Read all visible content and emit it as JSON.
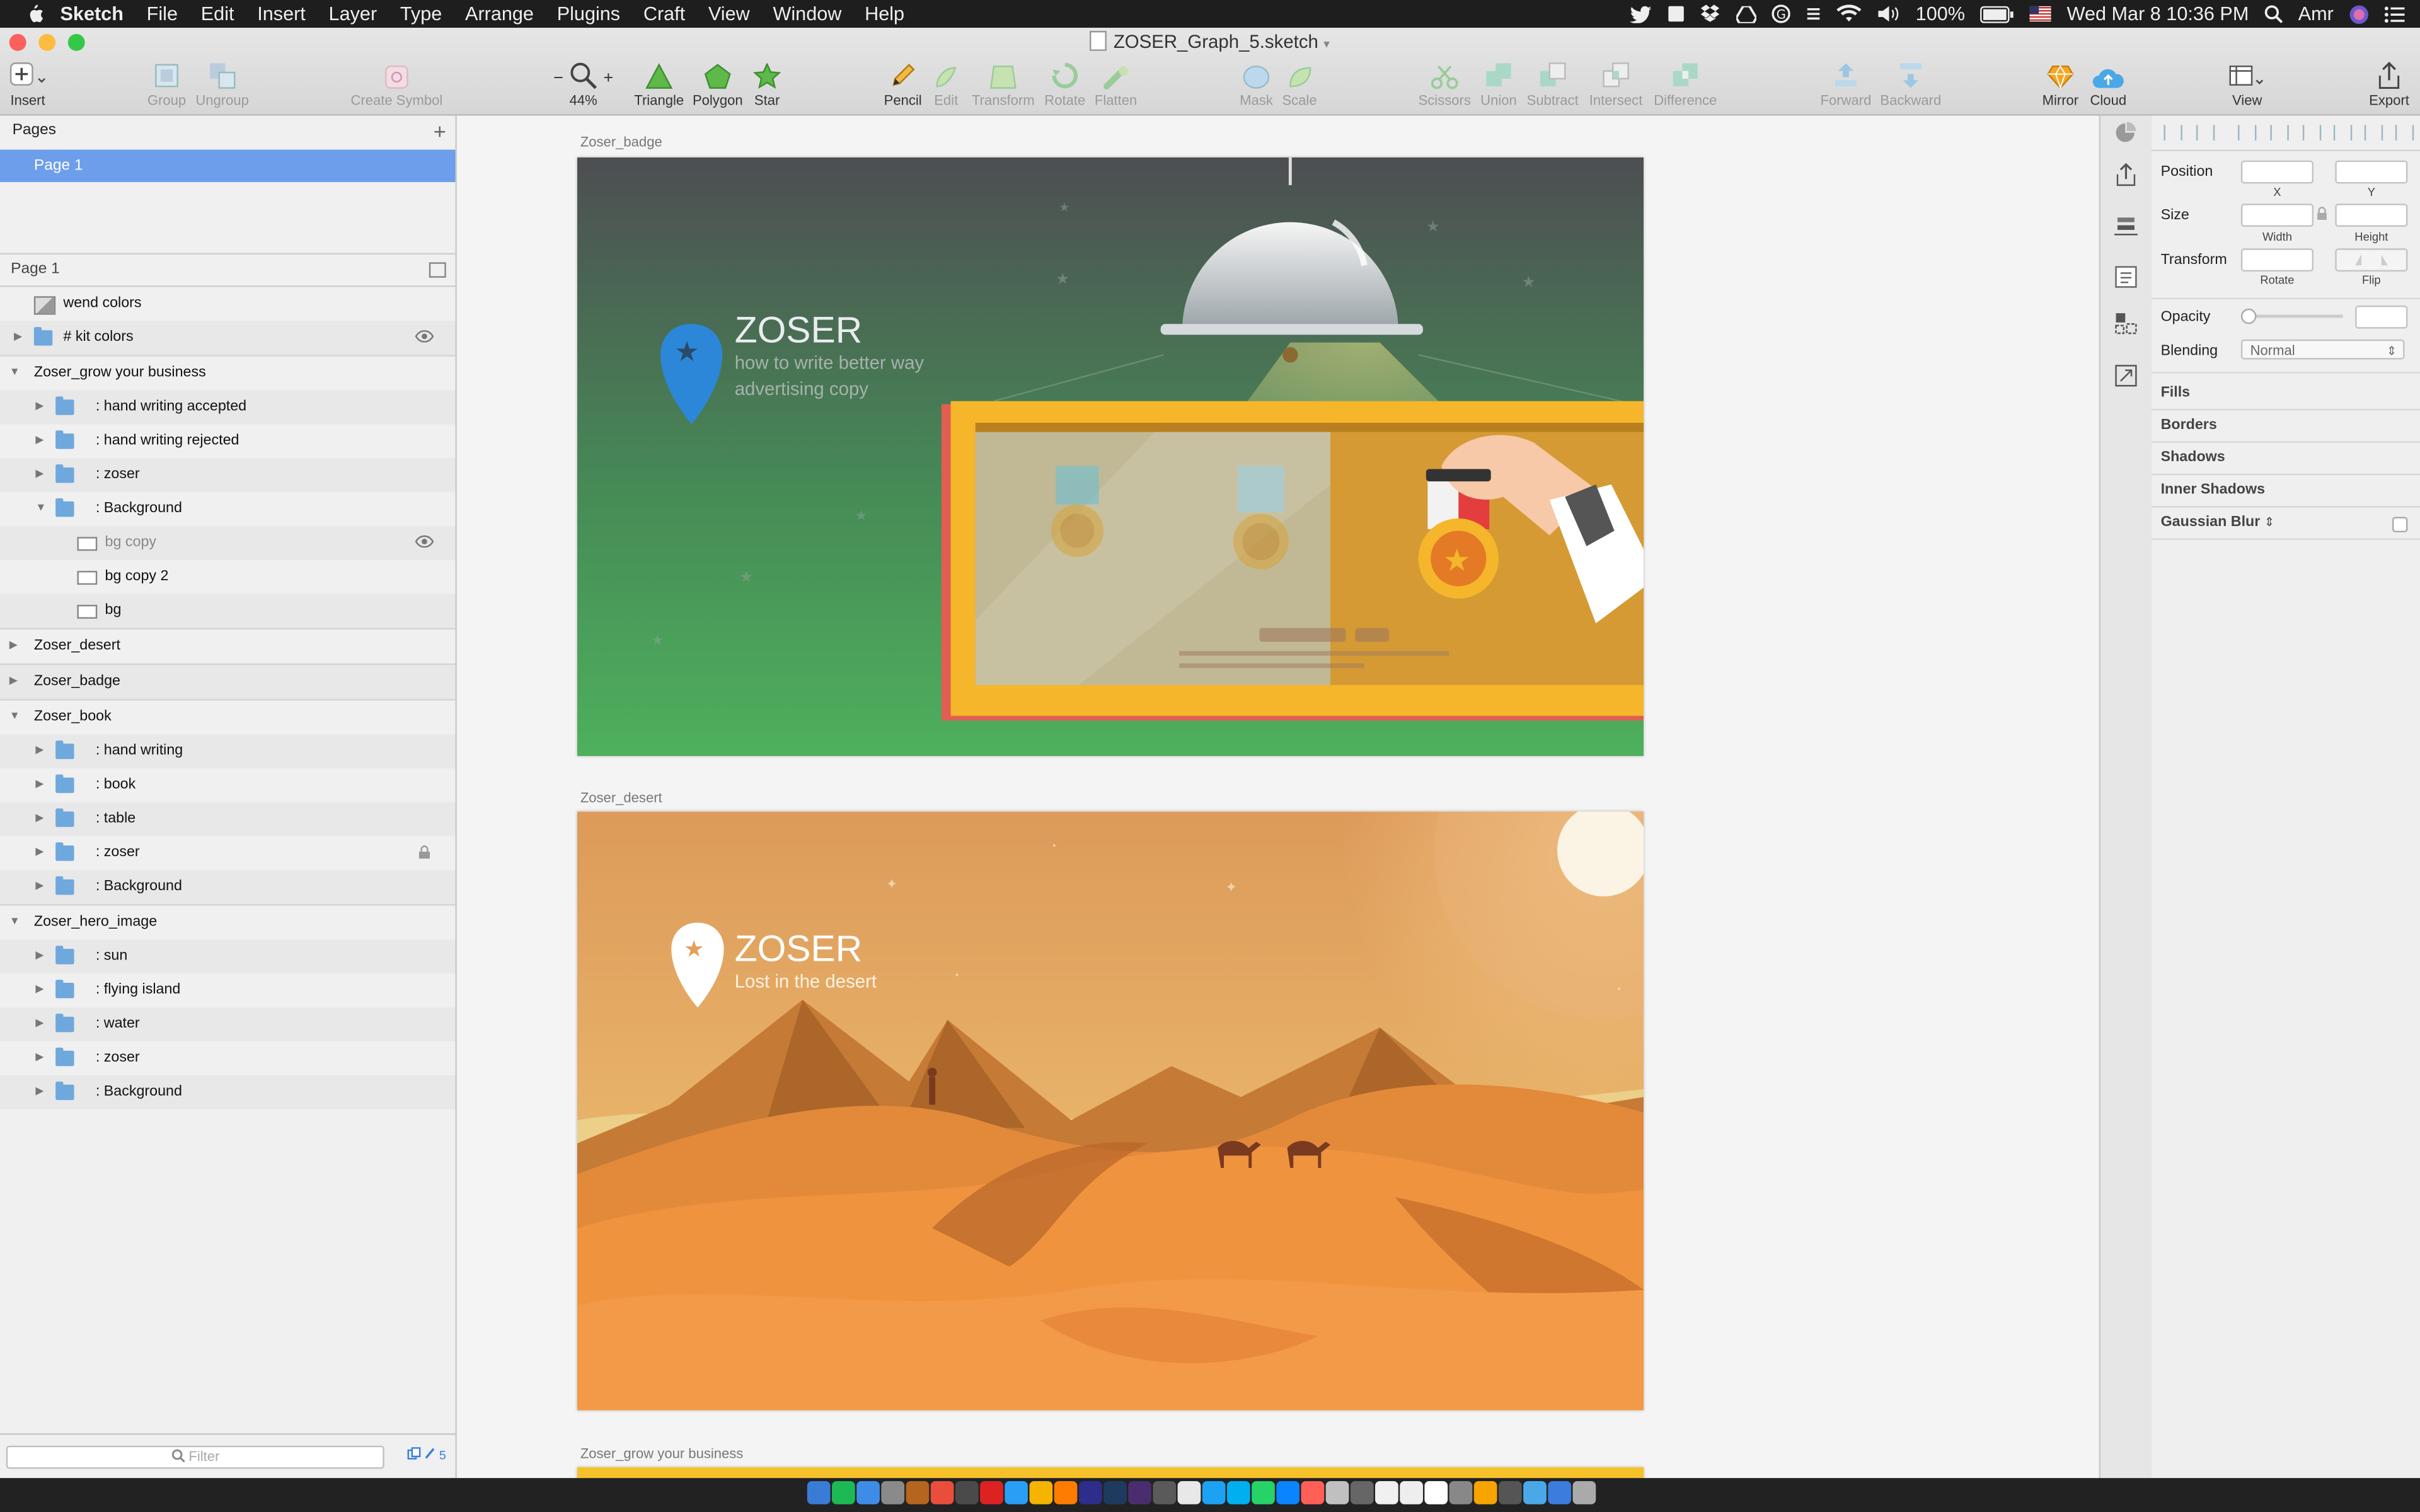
{
  "menubar": {
    "app_name": "Sketch",
    "menus": [
      "File",
      "Edit",
      "Insert",
      "Layer",
      "Type",
      "Arrange",
      "Plugins",
      "Craft",
      "View",
      "Window",
      "Help"
    ],
    "battery": "100%",
    "datetime": "Wed Mar 8  10:36 PM",
    "user": "Amr"
  },
  "window": {
    "title": "ZOSER_Graph_5.sketch"
  },
  "toolbar": {
    "insert": "Insert",
    "group": "Group",
    "ungroup": "Ungroup",
    "create_symbol": "Create Symbol",
    "zoom_minus": "−",
    "zoom_plus": "+",
    "zoom": "44%",
    "triangle": "Triangle",
    "polygon": "Polygon",
    "star": "Star",
    "pencil": "Pencil",
    "edit": "Edit",
    "transform": "Transform",
    "rotate": "Rotate",
    "flatten": "Flatten",
    "mask": "Mask",
    "scale": "Scale",
    "scissors": "Scissors",
    "union": "Union",
    "subtract": "Subtract",
    "intersect": "Intersect",
    "difference": "Difference",
    "forward": "Forward",
    "backward": "Backward",
    "mirror": "Mirror",
    "cloud": "Cloud",
    "view": "View",
    "export": "Export"
  },
  "sidebar": {
    "pages_title": "Pages",
    "add_page": "+",
    "pages": [
      "Page 1"
    ],
    "layers_title": "Page 1",
    "layers": [
      {
        "label": "wend colors",
        "kind": "image",
        "indent": 0,
        "arrow": "",
        "grey": false,
        "eye": false,
        "lock": false
      },
      {
        "label": "#  kit colors",
        "kind": "folder",
        "indent": 0,
        "arrow": "▶",
        "grey": false,
        "eye": true,
        "lock": false
      },
      {
        "label": "Zoser_grow your business",
        "kind": "artboard",
        "indent": 0,
        "arrow": "▼",
        "grey": false,
        "eye": false,
        "lock": false
      },
      {
        "label": ":  hand writing accepted",
        "kind": "folder",
        "indent": 1,
        "arrow": "▶",
        "grey": false,
        "eye": false,
        "lock": false
      },
      {
        "label": ":  hand writing  rejected",
        "kind": "folder",
        "indent": 1,
        "arrow": "▶",
        "grey": false,
        "eye": false,
        "lock": false
      },
      {
        "label": ":  zoser",
        "kind": "folder",
        "indent": 1,
        "arrow": "▶",
        "grey": false,
        "eye": false,
        "lock": false
      },
      {
        "label": ":  Background",
        "kind": "folder",
        "indent": 1,
        "arrow": "▼",
        "grey": false,
        "eye": false,
        "lock": false
      },
      {
        "label": "bg copy",
        "kind": "rect",
        "indent": 2,
        "arrow": "",
        "grey": true,
        "eye": true,
        "lock": false
      },
      {
        "label": "bg copy 2",
        "kind": "rect",
        "indent": 2,
        "arrow": "",
        "grey": false,
        "eye": false,
        "lock": false
      },
      {
        "label": "bg",
        "kind": "rect",
        "indent": 2,
        "arrow": "",
        "grey": false,
        "eye": false,
        "lock": false
      },
      {
        "label": "Zoser_desert",
        "kind": "artboard",
        "indent": 0,
        "arrow": "▶",
        "grey": false,
        "eye": false,
        "lock": false
      },
      {
        "label": "Zoser_badge",
        "kind": "artboard",
        "indent": 0,
        "arrow": "▶",
        "grey": false,
        "eye": false,
        "lock": false
      },
      {
        "label": "Zoser_book",
        "kind": "artboard",
        "indent": 0,
        "arrow": "▼",
        "grey": false,
        "eye": false,
        "lock": false
      },
      {
        "label": ":  hand writing",
        "kind": "folder",
        "indent": 1,
        "arrow": "▶",
        "grey": false,
        "eye": false,
        "lock": false
      },
      {
        "label": ":  book",
        "kind": "folder",
        "indent": 1,
        "arrow": "▶",
        "grey": false,
        "eye": false,
        "lock": false
      },
      {
        "label": ":  table",
        "kind": "folder",
        "indent": 1,
        "arrow": "▶",
        "grey": false,
        "eye": false,
        "lock": false
      },
      {
        "label": ":  zoser",
        "kind": "folder",
        "indent": 1,
        "arrow": "▶",
        "grey": false,
        "eye": false,
        "lock": true
      },
      {
        "label": ":  Background",
        "kind": "folder",
        "indent": 1,
        "arrow": "▶",
        "grey": false,
        "eye": false,
        "lock": false
      },
      {
        "label": "Zoser_hero_image",
        "kind": "artboard",
        "indent": 0,
        "arrow": "▼",
        "grey": false,
        "eye": false,
        "lock": false
      },
      {
        "label": ":  sun",
        "kind": "folder",
        "indent": 1,
        "arrow": "▶",
        "grey": false,
        "eye": false,
        "lock": false
      },
      {
        "label": ":  flying island",
        "kind": "folder",
        "indent": 1,
        "arrow": "▶",
        "grey": false,
        "eye": false,
        "lock": false
      },
      {
        "label": ":  water",
        "kind": "folder",
        "indent": 1,
        "arrow": "▶",
        "grey": false,
        "eye": false,
        "lock": false
      },
      {
        "label": ":  zoser",
        "kind": "folder",
        "indent": 1,
        "arrow": "▶",
        "grey": false,
        "eye": false,
        "lock": false
      },
      {
        "label": ":  Background",
        "kind": "folder",
        "indent": 1,
        "arrow": "▶",
        "grey": false,
        "eye": false,
        "lock": false
      }
    ],
    "filter_placeholder": "Filter",
    "filter_count": "5"
  },
  "canvas": {
    "badge": {
      "label": "Zoser_badge",
      "brand": "ZOSER",
      "tagline1": "how to write better way",
      "tagline2": "advertising copy"
    },
    "desert": {
      "label": "Zoser_desert",
      "brand": "ZOSER",
      "tagline": "Lost in the desert"
    },
    "grow": {
      "label": "Zoser_grow your business"
    }
  },
  "inspector": {
    "position": "Position",
    "x": "X",
    "y": "Y",
    "size": "Size",
    "width": "Width",
    "height": "Height",
    "transform": "Transform",
    "rotate": "Rotate",
    "flip": "Flip",
    "opacity": "Opacity",
    "blending": "Blending",
    "blending_value": "Normal",
    "fills": "Fills",
    "borders": "Borders",
    "shadows": "Shadows",
    "inner_shadows": "Inner Shadows",
    "gaussian_blur": "Gaussian Blur"
  },
  "colors": {
    "selection": "#6d9eeb",
    "folder": "#6fa8dc",
    "badge_bg_top": "#4f4f52",
    "badge_bg_bottom": "#4aa65a",
    "desert_sky": "#e2a35f",
    "desert_sand": "#ef8d34"
  }
}
